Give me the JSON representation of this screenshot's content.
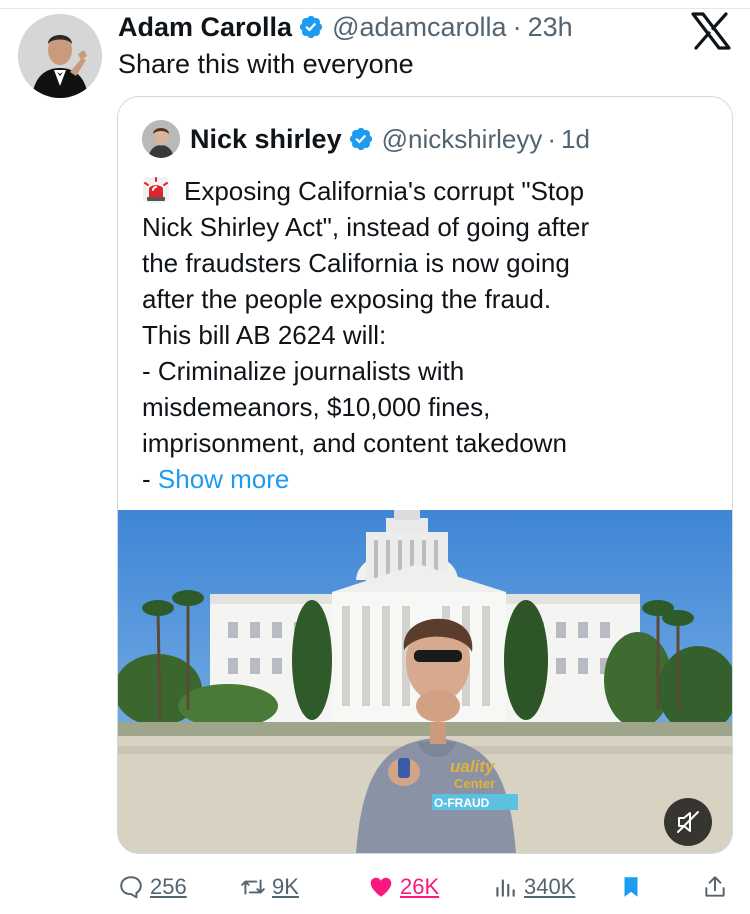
{
  "tweet": {
    "author_name": "Adam Carolla",
    "handle": "@adamcarolla",
    "separator": "·",
    "time": "23h",
    "text": "Share this with everyone"
  },
  "quote": {
    "author_name": "Nick shirley",
    "handle": "@nickshirleyy",
    "separator": "·",
    "time": "1d",
    "lines": [
      "Exposing California's corrupt \"Stop",
      "Nick Shirley Act\", instead of going after",
      "the fraudsters California is now going",
      "after the people exposing the fraud.",
      "This bill AB 2624 will:",
      "- Criminalize journalists with",
      "misdemeanors, $10,000 fines,",
      "imprisonment, and content takedown"
    ],
    "last_line_prefix": "- ",
    "show_more": "Show more",
    "media": {
      "hoodie_text_1": "uality",
      "hoodie_text_2": "Center",
      "hoodie_text_3": "O-FRAUD"
    }
  },
  "actions": {
    "replies": "256",
    "reposts": "9K",
    "likes": "26K",
    "views": "340K"
  },
  "colors": {
    "accent": "#1d9bf0",
    "like": "#f91880",
    "muted": "#536471",
    "text": "#0f1419"
  },
  "icons": [
    "x-logo-icon",
    "verified-badge-icon",
    "siren-icon",
    "mute-icon",
    "reply-icon",
    "repost-icon",
    "heart-icon",
    "views-icon",
    "bookmark-icon",
    "share-icon"
  ]
}
